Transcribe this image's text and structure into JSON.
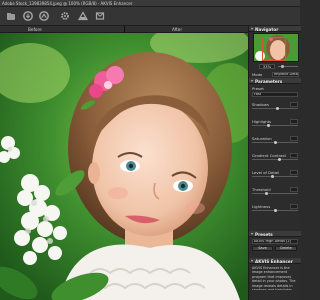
{
  "window": {
    "title": "Adobe Stock_139839854.jpeg @ 100% (RGB/8) · AKVIS Enhancer"
  },
  "toolbar": {
    "icons": [
      "open-icon",
      "save-icon",
      "settings-icon",
      "gear-icon",
      "print-icon",
      "share-icon"
    ]
  },
  "view_tabs": {
    "before": "Before",
    "after": "After"
  },
  "navigator": {
    "title": "Navigator",
    "zoom": "33%"
  },
  "parameters": {
    "mode_label": "Mode",
    "mode_value": "Improve Detail",
    "title": "Parameters",
    "preset_label": "Preset",
    "preview": "Fast",
    "sliders": [
      {
        "label": "Shadows",
        "value": 0.55
      },
      {
        "label": "Highlights",
        "value": 0.35
      },
      {
        "label": "Saturation",
        "value": 0.5
      },
      {
        "label": "Gradient Contrast",
        "value": 0.6
      },
      {
        "label": "Level of Detail",
        "value": 0.45
      },
      {
        "label": "Threshold",
        "value": 0.3
      },
      {
        "label": "Lightness",
        "value": 0.5
      }
    ]
  },
  "presets": {
    "title": "Presets",
    "value": "AKVIS High Detail (2)",
    "save": "Save",
    "delete": "Delete"
  },
  "info": {
    "title": "AKVIS Enhancer",
    "text": "AKVIS Enhancer is the image enhancement program that improves detail in your photos. The image reveals details in shadows and highlights. Run this tool over a photo of your choice."
  },
  "colors": {
    "accent": "#e0523a",
    "panel": "#2c2c2c",
    "toolbar": "#353535"
  }
}
